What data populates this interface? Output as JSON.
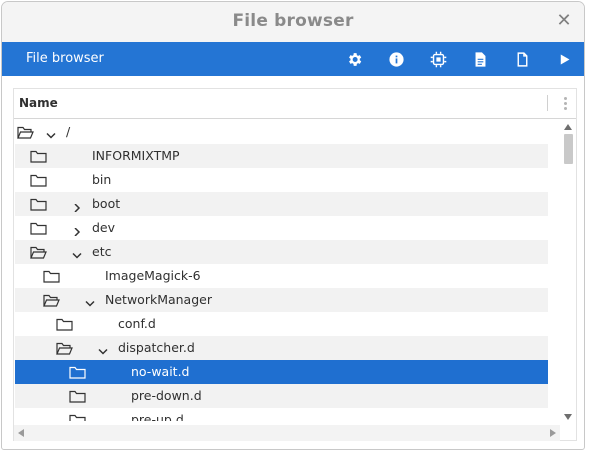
{
  "window": {
    "title": "File browser",
    "close_icon": "close-icon"
  },
  "toolbar": {
    "title": "File browser",
    "buttons": [
      {
        "name": "settings-button",
        "icon": "gear-icon"
      },
      {
        "name": "info-button",
        "icon": "info-icon"
      },
      {
        "name": "chip-button",
        "icon": "chip-icon"
      },
      {
        "name": "document-button",
        "icon": "document-icon"
      },
      {
        "name": "new-file-button",
        "icon": "new-file-icon"
      },
      {
        "name": "run-button",
        "icon": "play-icon"
      }
    ],
    "accent": "#2475d4"
  },
  "table": {
    "column_header": "Name",
    "rows": [
      {
        "label": "/",
        "depth": 0,
        "state": "expanded"
      },
      {
        "label": "INFORMIXTMP",
        "depth": 1,
        "state": "leaf"
      },
      {
        "label": "bin",
        "depth": 1,
        "state": "leaf"
      },
      {
        "label": "boot",
        "depth": 1,
        "state": "collapsed"
      },
      {
        "label": "dev",
        "depth": 1,
        "state": "collapsed"
      },
      {
        "label": "etc",
        "depth": 1,
        "state": "expanded"
      },
      {
        "label": "ImageMagick-6",
        "depth": 2,
        "state": "leaf"
      },
      {
        "label": "NetworkManager",
        "depth": 2,
        "state": "expanded"
      },
      {
        "label": "conf.d",
        "depth": 3,
        "state": "leaf"
      },
      {
        "label": "dispatcher.d",
        "depth": 3,
        "state": "expanded"
      },
      {
        "label": "no-wait.d",
        "depth": 4,
        "state": "leaf",
        "selected": true
      },
      {
        "label": "pre-down.d",
        "depth": 4,
        "state": "leaf"
      },
      {
        "label": "pre-up.d",
        "depth": 4,
        "state": "leaf"
      }
    ],
    "selection_color": "#1f6fd0"
  }
}
